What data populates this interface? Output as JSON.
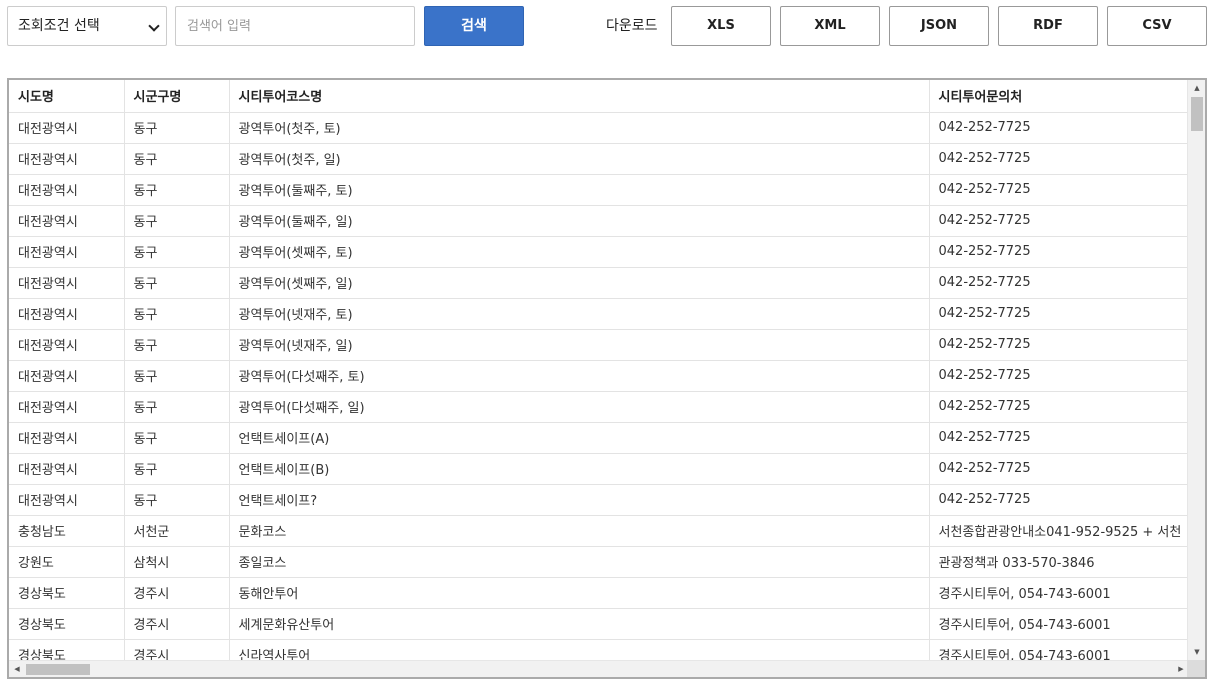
{
  "toolbar": {
    "condition_select": "조회조건 선택",
    "search_placeholder": "검색어 입력",
    "search_button": "검색",
    "download_label": "다운로드",
    "download_buttons": [
      "XLS",
      "XML",
      "JSON",
      "RDF",
      "CSV"
    ]
  },
  "table": {
    "headers": [
      "시도명",
      "시군구명",
      "시티투어코스명",
      "시티투어문의처"
    ],
    "rows": [
      [
        "대전광역시",
        "동구",
        "광역투어(첫주, 토)",
        "042-252-7725"
      ],
      [
        "대전광역시",
        "동구",
        "광역투어(첫주, 일)",
        "042-252-7725"
      ],
      [
        "대전광역시",
        "동구",
        "광역투어(둘째주, 토)",
        "042-252-7725"
      ],
      [
        "대전광역시",
        "동구",
        "광역투어(둘째주, 일)",
        "042-252-7725"
      ],
      [
        "대전광역시",
        "동구",
        "광역투어(셋째주, 토)",
        "042-252-7725"
      ],
      [
        "대전광역시",
        "동구",
        "광역투어(셋째주, 일)",
        "042-252-7725"
      ],
      [
        "대전광역시",
        "동구",
        "광역투어(넷재주, 토)",
        "042-252-7725"
      ],
      [
        "대전광역시",
        "동구",
        "광역투어(넷재주, 일)",
        "042-252-7725"
      ],
      [
        "대전광역시",
        "동구",
        "광역투어(다섯째주, 토)",
        "042-252-7725"
      ],
      [
        "대전광역시",
        "동구",
        "광역투어(다섯째주, 일)",
        "042-252-7725"
      ],
      [
        "대전광역시",
        "동구",
        "언택트세이프(A)",
        "042-252-7725"
      ],
      [
        "대전광역시",
        "동구",
        "언택트세이프(B)",
        "042-252-7725"
      ],
      [
        "대전광역시",
        "동구",
        "언택트세이프?",
        "042-252-7725"
      ],
      [
        "충청남도",
        "서천군",
        "문화코스",
        "서천종합관광안내소041-952-9525 + 서천"
      ],
      [
        "강원도",
        "삼척시",
        "종일코스",
        "관광정책과 033-570-3846"
      ],
      [
        "경상북도",
        "경주시",
        "동해안투어",
        "경주시티투어, 054-743-6001"
      ],
      [
        "경상북도",
        "경주시",
        "세계문화유산투어",
        "경주시티투어, 054-743-6001"
      ],
      [
        "경상북도",
        "경주시",
        "신라역사투어",
        "경주시티투어, 054-743-6001"
      ]
    ]
  }
}
